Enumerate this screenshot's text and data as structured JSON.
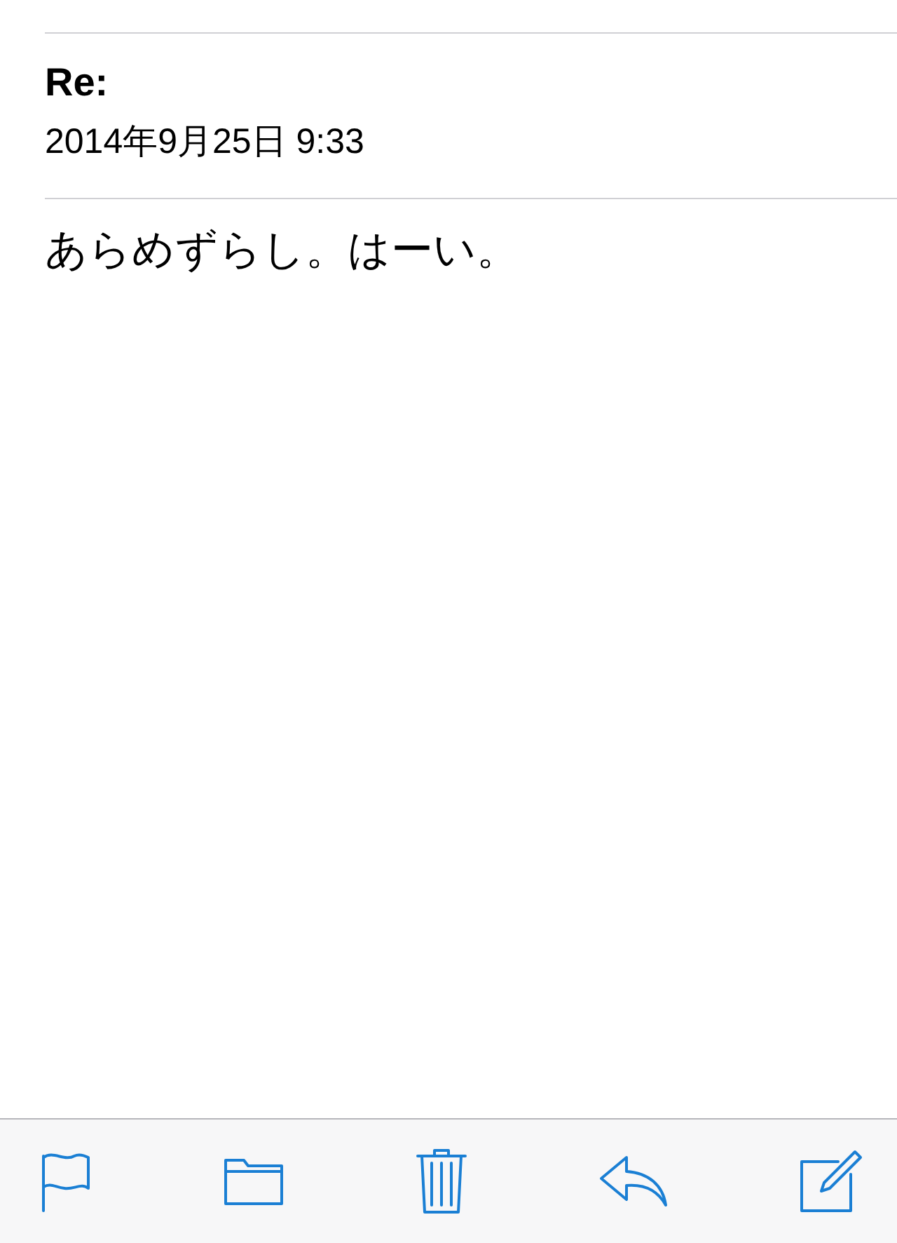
{
  "message": {
    "subject": "Re:",
    "date": "2014年9月25日 9:33",
    "body": "あらめずらし。はーい。"
  }
}
